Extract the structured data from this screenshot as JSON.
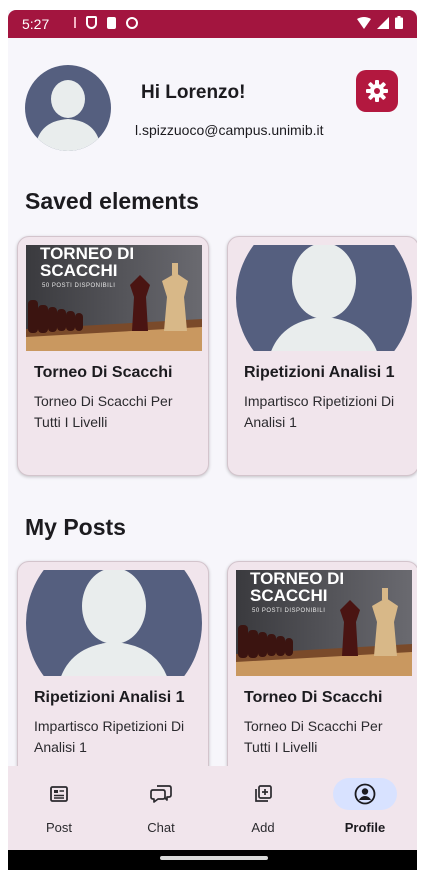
{
  "status_bar": {
    "time": "5:27",
    "icons": [
      "download-icon",
      "shield-icon",
      "sim-card-icon",
      "sync-icon",
      "wifi-icon",
      "signal-icon",
      "battery-icon"
    ]
  },
  "profile": {
    "greeting": "Hi Lorenzo!",
    "email": "l.spizzuoco@campus.unimib.it",
    "settings_icon": "gear-icon"
  },
  "saved_section": {
    "title": "Saved elements",
    "items": [
      {
        "title": "Torneo Di Scacchi",
        "description": "Torneo Di Scacchi Per Tutti I Livelli",
        "image": "chess-image",
        "image_caption": "TORNEO DI SCACCHI",
        "image_subcaption": "50 POSTI DISPONIBILI"
      },
      {
        "title": "Ripetizioni Analisi 1",
        "description": "Impartisco Ripetizioni Di Analisi 1",
        "image": "avatar-placeholder-image"
      }
    ]
  },
  "posts_section": {
    "title": "My Posts",
    "items": [
      {
        "title": "Ripetizioni Analisi 1",
        "description": "Impartisco Ripetizioni Di Analisi 1",
        "image": "avatar-placeholder-image"
      },
      {
        "title": "Torneo Di Scacchi",
        "description": "Torneo Di Scacchi Per Tutti I Livelli",
        "image": "chess-image",
        "image_caption": "TORNEO DI SCACCHI",
        "image_subcaption": "50 POSTI DISPONIBILI"
      }
    ]
  },
  "bottom_nav": {
    "items": [
      {
        "label": "Post",
        "icon": "article-icon",
        "active": false
      },
      {
        "label": "Chat",
        "icon": "chat-icon",
        "active": false
      },
      {
        "label": "Add",
        "icon": "add-library-icon",
        "active": false
      },
      {
        "label": "Profile",
        "icon": "account-circle-icon",
        "active": true
      }
    ]
  },
  "colors": {
    "status_bar": "#a3153f",
    "accent": "#b3183f",
    "card_background": "#f1e5ec",
    "active_pill": "#d8e2ff",
    "avatar_background": "#555f7f"
  }
}
